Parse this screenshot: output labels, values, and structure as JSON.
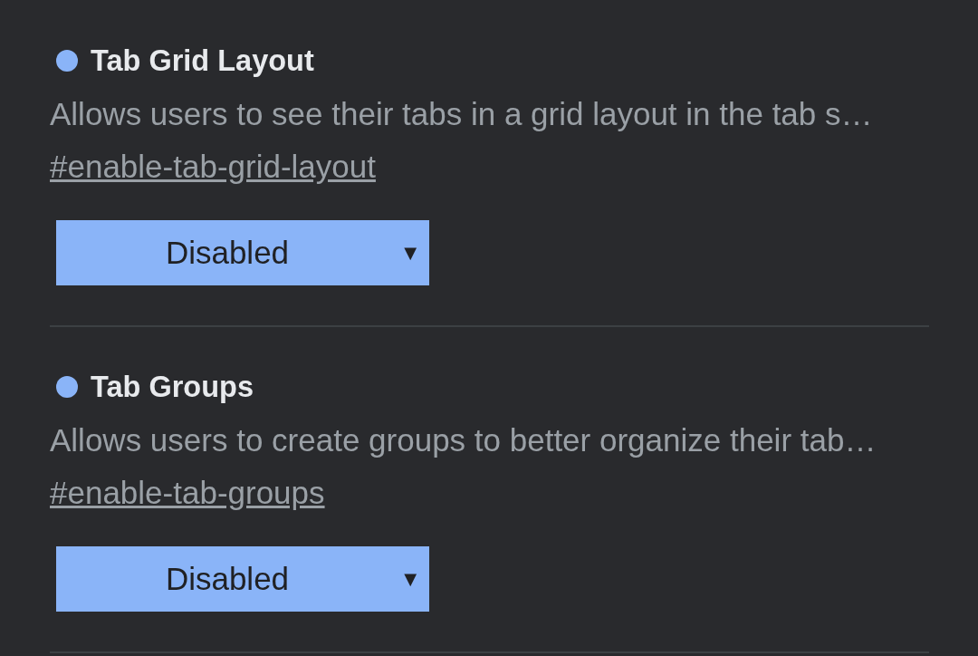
{
  "flags": [
    {
      "title": "Tab Grid Layout",
      "description": "Allows users to see their tabs in a grid layout in the tab s…",
      "link": "#enable-tab-grid-layout",
      "dropdown": {
        "value": "Disabled",
        "caret": "▼"
      }
    },
    {
      "title": "Tab Groups",
      "description": "Allows users to create groups to better organize their tab…",
      "link": "#enable-tab-groups",
      "dropdown": {
        "value": "Disabled",
        "caret": "▼"
      }
    }
  ]
}
